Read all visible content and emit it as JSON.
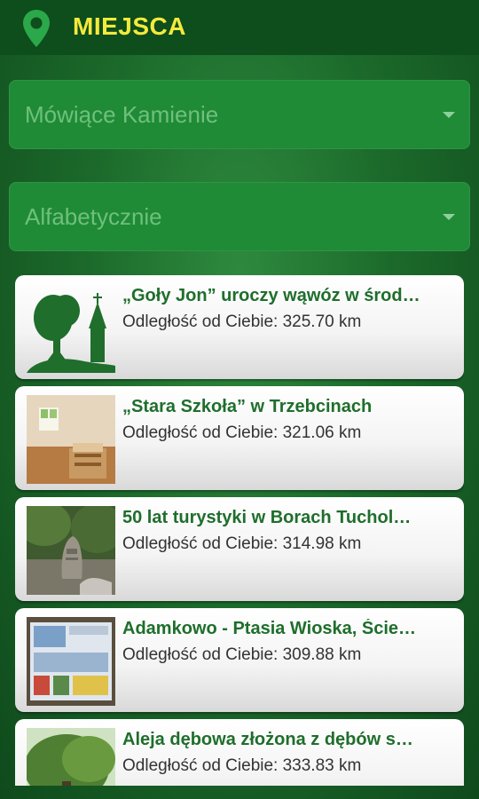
{
  "header": {
    "title": "MIEJSCA",
    "icon": "map-pin-icon"
  },
  "filters": {
    "category": {
      "value": "Mówiące Kamienie"
    },
    "sort": {
      "value": "Alfabetycznie"
    }
  },
  "colors": {
    "header_bg": "#0e4d1c",
    "title_color": "#f4ea3c",
    "card_title": "#1f6e2c",
    "dropdown_bg": "#1f8b36"
  },
  "places": [
    {
      "title": "„Goły Jon” uroczy wąwóz w środ…",
      "distance": "Odległość od Ciebie: 325.70 km",
      "thumb": "tree-church-icon"
    },
    {
      "title": "„Stara Szkoła” w Trzebcinach",
      "distance": "Odległość od Ciebie: 321.06 km",
      "thumb": "room-photo"
    },
    {
      "title": "50 lat turystyki w Borach Tuchol…",
      "distance": "Odległość od Ciebie: 314.98 km",
      "thumb": "stone-monument-photo"
    },
    {
      "title": "Adamkowo - Ptasia Wioska, Ście…",
      "distance": "Odległość od Ciebie: 309.88 km",
      "thumb": "info-board-photo"
    },
    {
      "title": "Aleja dębowa złożona z dębów s…",
      "distance": "Odległość od Ciebie: 333.83 km",
      "thumb": "oak-tree-photo"
    }
  ]
}
